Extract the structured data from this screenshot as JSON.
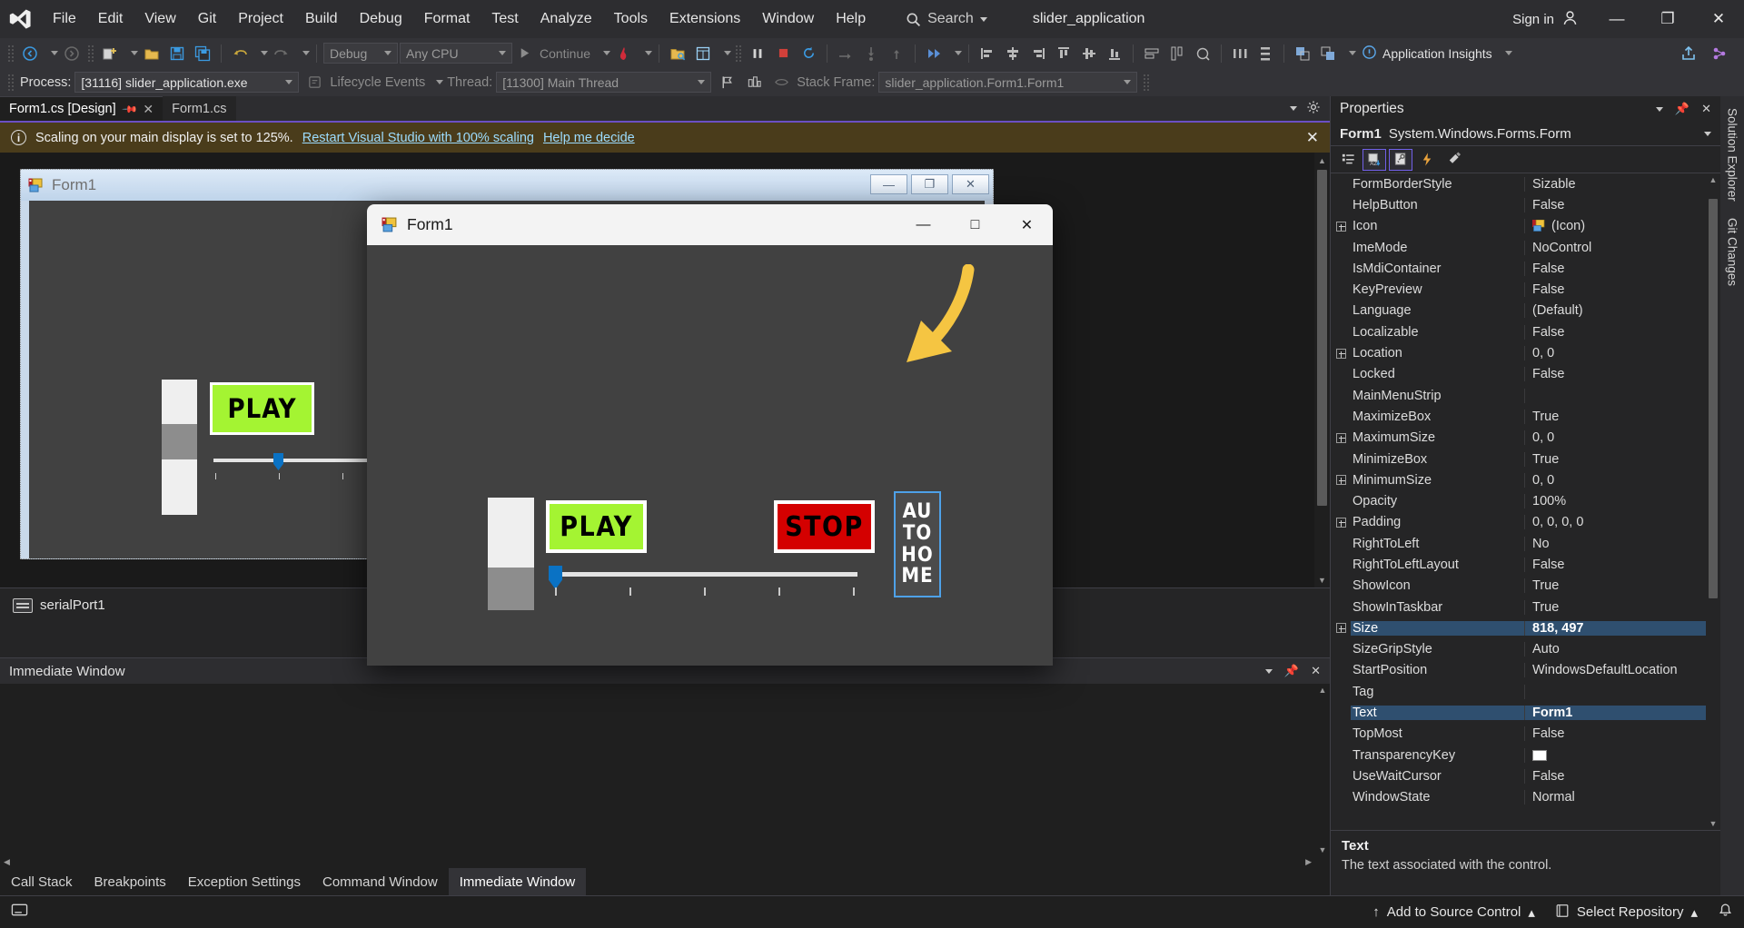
{
  "titlebar": {
    "menu": [
      "File",
      "Edit",
      "View",
      "Git",
      "Project",
      "Build",
      "Debug",
      "Format",
      "Test",
      "Analyze",
      "Tools",
      "Extensions",
      "Window",
      "Help"
    ],
    "search_label": "Search",
    "solution_name": "slider_application",
    "signin_label": "Sign in",
    "minimize": "—",
    "maximize": "❐",
    "close": "✕"
  },
  "toolbar": {
    "config_value": "Debug",
    "platform_value": "Any CPU",
    "continue_label": "Continue",
    "app_insights_label": "Application Insights"
  },
  "debugbar": {
    "process_label": "Process:",
    "process_value": "[31116] slider_application.exe",
    "lifecycle_label": "Lifecycle Events",
    "thread_label": "Thread:",
    "thread_value": "[11300] Main Thread",
    "stackframe_label": "Stack Frame:",
    "stackframe_value": "slider_application.Form1.Form1"
  },
  "tabs": [
    {
      "label": "Form1.cs [Design]",
      "active": true
    },
    {
      "label": "Form1.cs",
      "active": false
    }
  ],
  "infobar": {
    "message": "Scaling on your main display is set to 125%.",
    "link1": "Restart Visual Studio with 100% scaling",
    "link2": "Help me decide",
    "close": "✕"
  },
  "designer": {
    "form_title": "Form1",
    "minimize": "—",
    "maximize": "❐",
    "close": "✕",
    "play_label": "PLAY"
  },
  "tray": {
    "item_label": "serialPort1"
  },
  "immediate": {
    "title": "Immediate Window",
    "caret": "▾",
    "pin": "📌",
    "close": "✕"
  },
  "bottom_tabs": [
    {
      "label": "Call Stack",
      "active": false
    },
    {
      "label": "Breakpoints",
      "active": false
    },
    {
      "label": "Exception Settings",
      "active": false
    },
    {
      "label": "Command Window",
      "active": false
    },
    {
      "label": "Immediate Window",
      "active": true
    }
  ],
  "properties": {
    "title": "Properties",
    "caret": "▾",
    "pin": "📌",
    "close": "✕",
    "object_name": "Form1",
    "object_type": "System.Windows.Forms.Form",
    "rows": [
      {
        "name": "FormBorderStyle",
        "value": "Sizable",
        "expandable": false,
        "selected": false
      },
      {
        "name": "HelpButton",
        "value": "False",
        "expandable": false,
        "selected": false
      },
      {
        "name": "Icon",
        "value": "(Icon)",
        "expandable": true,
        "selected": false,
        "icon": true
      },
      {
        "name": "ImeMode",
        "value": "NoControl",
        "expandable": false,
        "selected": false
      },
      {
        "name": "IsMdiContainer",
        "value": "False",
        "expandable": false,
        "selected": false
      },
      {
        "name": "KeyPreview",
        "value": "False",
        "expandable": false,
        "selected": false
      },
      {
        "name": "Language",
        "value": "(Default)",
        "expandable": false,
        "selected": false
      },
      {
        "name": "Localizable",
        "value": "False",
        "expandable": false,
        "selected": false
      },
      {
        "name": "Location",
        "value": "0, 0",
        "expandable": true,
        "selected": false
      },
      {
        "name": "Locked",
        "value": "False",
        "expandable": false,
        "selected": false
      },
      {
        "name": "MainMenuStrip",
        "value": "",
        "expandable": false,
        "selected": false
      },
      {
        "name": "MaximizeBox",
        "value": "True",
        "expandable": false,
        "selected": false
      },
      {
        "name": "MaximumSize",
        "value": "0, 0",
        "expandable": true,
        "selected": false
      },
      {
        "name": "MinimizeBox",
        "value": "True",
        "expandable": false,
        "selected": false
      },
      {
        "name": "MinimumSize",
        "value": "0, 0",
        "expandable": true,
        "selected": false
      },
      {
        "name": "Opacity",
        "value": "100%",
        "expandable": false,
        "selected": false
      },
      {
        "name": "Padding",
        "value": "0, 0, 0, 0",
        "expandable": true,
        "selected": false
      },
      {
        "name": "RightToLeft",
        "value": "No",
        "expandable": false,
        "selected": false
      },
      {
        "name": "RightToLeftLayout",
        "value": "False",
        "expandable": false,
        "selected": false
      },
      {
        "name": "ShowIcon",
        "value": "True",
        "expandable": false,
        "selected": false
      },
      {
        "name": "ShowInTaskbar",
        "value": "True",
        "expandable": false,
        "selected": false
      },
      {
        "name": "Size",
        "value": "818, 497",
        "expandable": true,
        "selected": true
      },
      {
        "name": "SizeGripStyle",
        "value": "Auto",
        "expandable": false,
        "selected": false
      },
      {
        "name": "StartPosition",
        "value": "WindowsDefaultLocation",
        "expandable": false,
        "selected": false
      },
      {
        "name": "Tag",
        "value": "",
        "expandable": false,
        "selected": false
      },
      {
        "name": "Text",
        "value": "Form1",
        "expandable": false,
        "selected": true
      },
      {
        "name": "TopMost",
        "value": "False",
        "expandable": false,
        "selected": false
      },
      {
        "name": "TransparencyKey",
        "value": "",
        "expandable": false,
        "selected": false,
        "swatch": true
      },
      {
        "name": "UseWaitCursor",
        "value": "False",
        "expandable": false,
        "selected": false
      },
      {
        "name": "WindowState",
        "value": "Normal",
        "expandable": false,
        "selected": false
      }
    ],
    "description_title": "Text",
    "description_text": "The text associated with the control."
  },
  "dock_right": [
    "Solution Explorer",
    "Git Changes"
  ],
  "statusbar": {
    "add_to_source_control": "Add to Source Control",
    "select_repository": "Select Repository",
    "caret_up": "▴"
  },
  "run_window": {
    "title": "Form1",
    "minimize": "—",
    "maximize": "□",
    "close": "✕",
    "play_label": "PLAY",
    "stop_label": "STOP",
    "auto_home_lines": [
      "AU",
      "TO",
      "HO",
      "ME"
    ]
  },
  "colors": {
    "play_green": "#a4f432",
    "stop_red": "#d40000",
    "slider_blue": "#0a72c4",
    "annotation_yellow": "#f5c542",
    "accent_purple": "#6b4fc4",
    "infobar_bg": "#4a3c1b"
  }
}
